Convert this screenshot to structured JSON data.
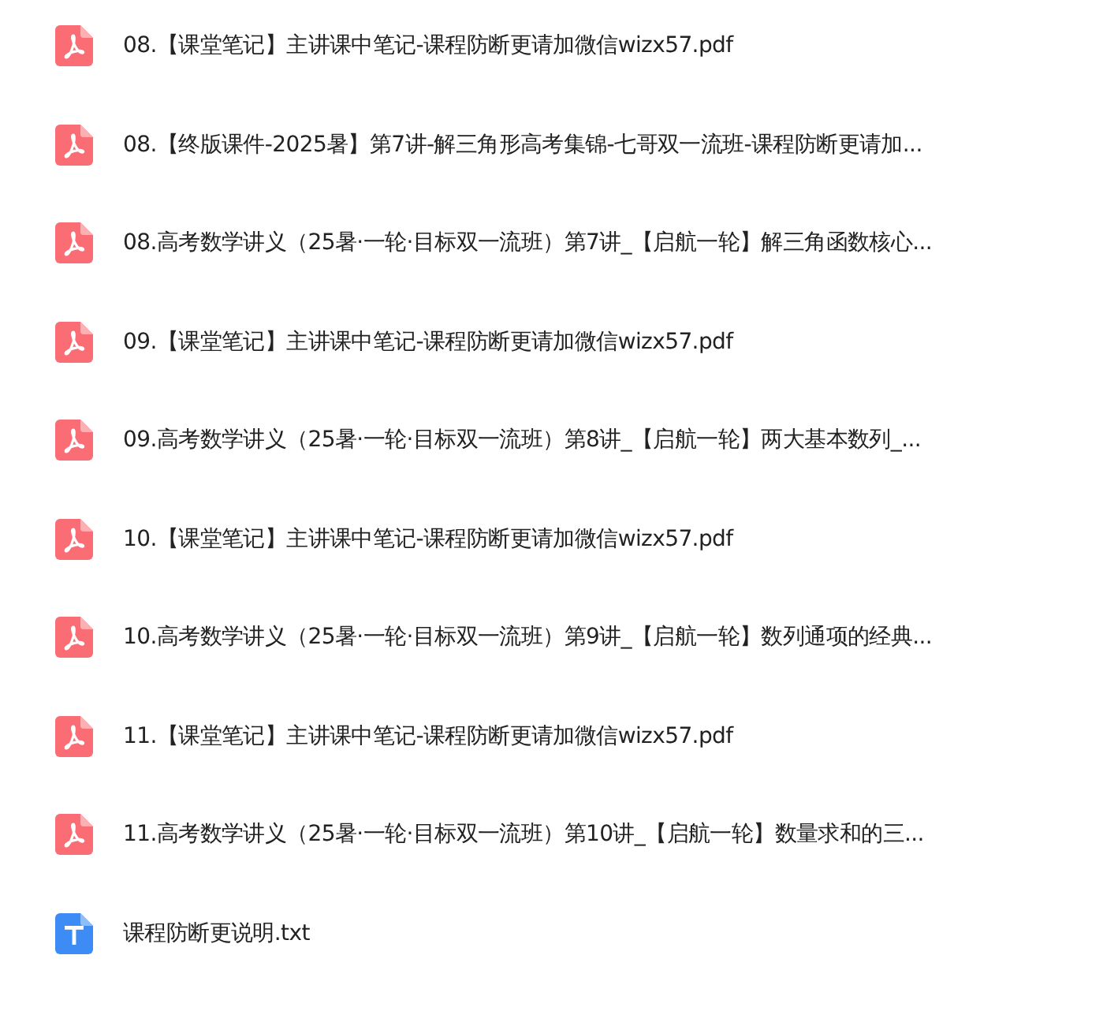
{
  "files": [
    {
      "kind": "pdf",
      "name": "08.【课堂笔记】主讲课中笔记-课程防断更请加微信wizx57.pdf"
    },
    {
      "kind": "pdf",
      "name": "08.【终版课件-2025暑】第7讲-解三角形高考集锦-七哥双一流班-课程防断更请加..."
    },
    {
      "kind": "pdf",
      "name": "08.高考数学讲义（25暑·一轮·目标双一流班）第7讲_【启航一轮】解三角函数核心..."
    },
    {
      "kind": "pdf",
      "name": "09.【课堂笔记】主讲课中笔记-课程防断更请加微信wizx57.pdf"
    },
    {
      "kind": "pdf",
      "name": "09.高考数学讲义（25暑·一轮·目标双一流班）第8讲_【启航一轮】两大基本数列_..."
    },
    {
      "kind": "pdf",
      "name": "10.【课堂笔记】主讲课中笔记-课程防断更请加微信wizx57.pdf"
    },
    {
      "kind": "pdf",
      "name": "10.高考数学讲义（25暑·一轮·目标双一流班）第9讲_【启航一轮】数列通项的经典..."
    },
    {
      "kind": "pdf",
      "name": "11.【课堂笔记】主讲课中笔记-课程防断更请加微信wizx57.pdf"
    },
    {
      "kind": "pdf",
      "name": "11.高考数学讲义（25暑·一轮·目标双一流班）第10讲_【启航一轮】数量求和的三..."
    },
    {
      "kind": "txt",
      "name": "课程防断更说明.txt"
    }
  ]
}
